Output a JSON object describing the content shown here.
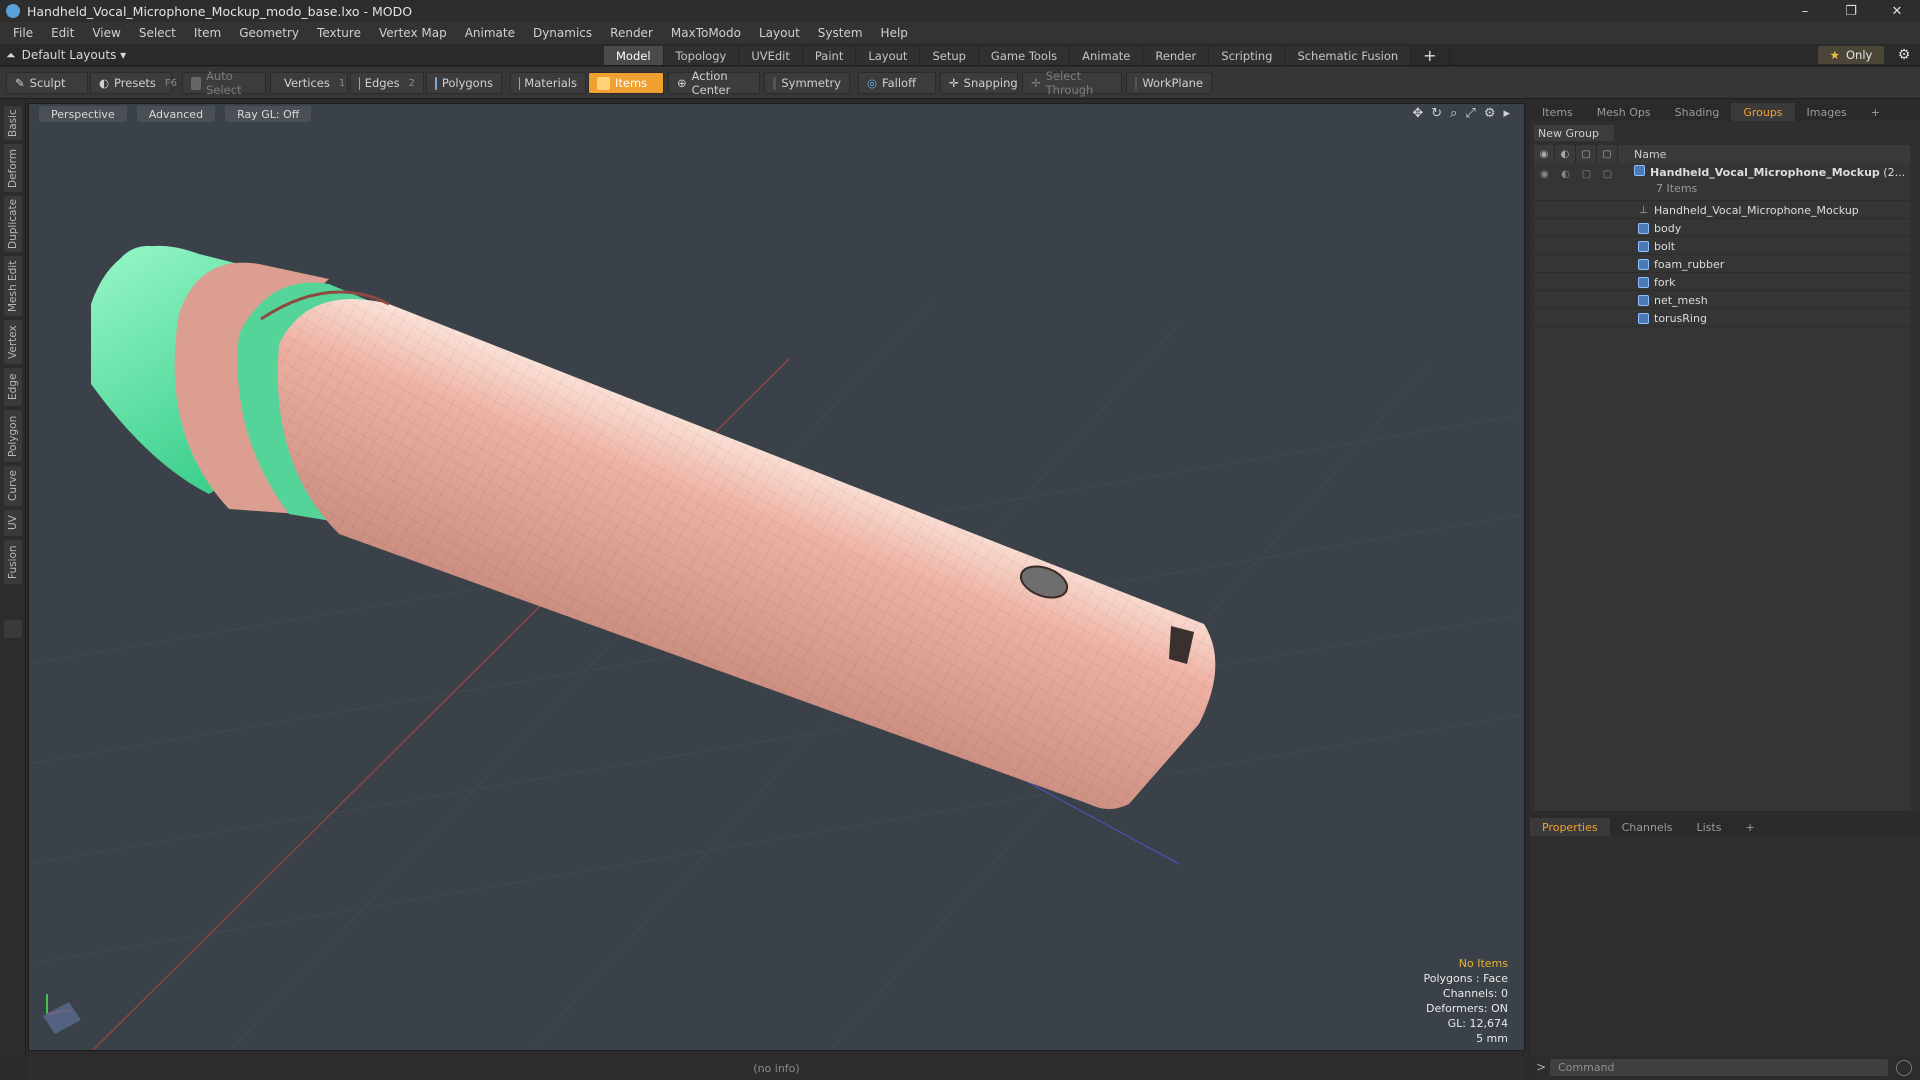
{
  "window": {
    "title": "Handheld_Vocal_Microphone_Mockup_modo_base.lxo - MODO",
    "minimize": "–",
    "maximize": "❐",
    "close": "✕"
  },
  "menu": [
    "File",
    "Edit",
    "View",
    "Select",
    "Item",
    "Geometry",
    "Texture",
    "Vertex Map",
    "Animate",
    "Dynamics",
    "Render",
    "MaxToModo",
    "Layout",
    "System",
    "Help"
  ],
  "layout": {
    "selector": "Default Layouts ▾",
    "tabs": [
      "Model",
      "Topology",
      "UVEdit",
      "Paint",
      "Layout",
      "Setup",
      "Game Tools",
      "Animate",
      "Render",
      "Scripting",
      "Schematic Fusion"
    ],
    "active_tab": "Model",
    "add": "+",
    "only": "Only"
  },
  "toolbar": {
    "sculpt": "Sculpt",
    "presets": "Presets",
    "presets_key": "F6",
    "auto_select": "Auto Select",
    "vertices": "Vertices",
    "vertices_key": "1",
    "edges": "Edges",
    "edges_key": "2",
    "polygons": "Polygons",
    "materials": "Materials",
    "items": "Items",
    "action_center": "Action Center",
    "symmetry": "Symmetry",
    "falloff": "Falloff",
    "snapping": "Snapping",
    "select_through": "Select Through",
    "workplane": "WorkPlane"
  },
  "left_tabs": [
    "Basic",
    "Deform",
    "Duplicate",
    "Mesh Edit",
    "Vertex",
    "Edge",
    "Polygon",
    "Curve",
    "UV",
    "Fusion"
  ],
  "viewport": {
    "view": "Perspective",
    "shading": "Advanced",
    "raygl": "Ray GL: Off"
  },
  "stats": {
    "no_items": "No Items",
    "polygons": "Polygons : Face",
    "channels": "Channels: 0",
    "deformers": "Deformers: ON",
    "gl": "GL: 12,674",
    "unit": "5 mm"
  },
  "status": "(no info)",
  "right_panel": {
    "tabs": [
      "Items",
      "Mesh Ops",
      "Shading",
      "Groups",
      "Images",
      "+"
    ],
    "active_tab": "Groups",
    "new_group": "New Group",
    "name_col": "Name",
    "group": {
      "name": "Handheld_Vocal_Microphone_Mockup",
      "suffix": "(2...",
      "count": "7 Items"
    },
    "items": [
      "Handheld_Vocal_Microphone_Mockup",
      "body",
      "bolt",
      "foam_rubber",
      "fork",
      "net_mesh",
      "torusRing"
    ]
  },
  "bottom_panel": {
    "tabs": [
      "Properties",
      "Channels",
      "Lists",
      "+"
    ],
    "active_tab": "Properties"
  },
  "command": {
    "placeholder": "Command",
    "prompt": ">"
  },
  "colors": {
    "accent": "#f0a030",
    "mesh_body": "#e8a898",
    "mesh_foam": "#62e3a6",
    "viewport_bg": "#3b4148"
  }
}
